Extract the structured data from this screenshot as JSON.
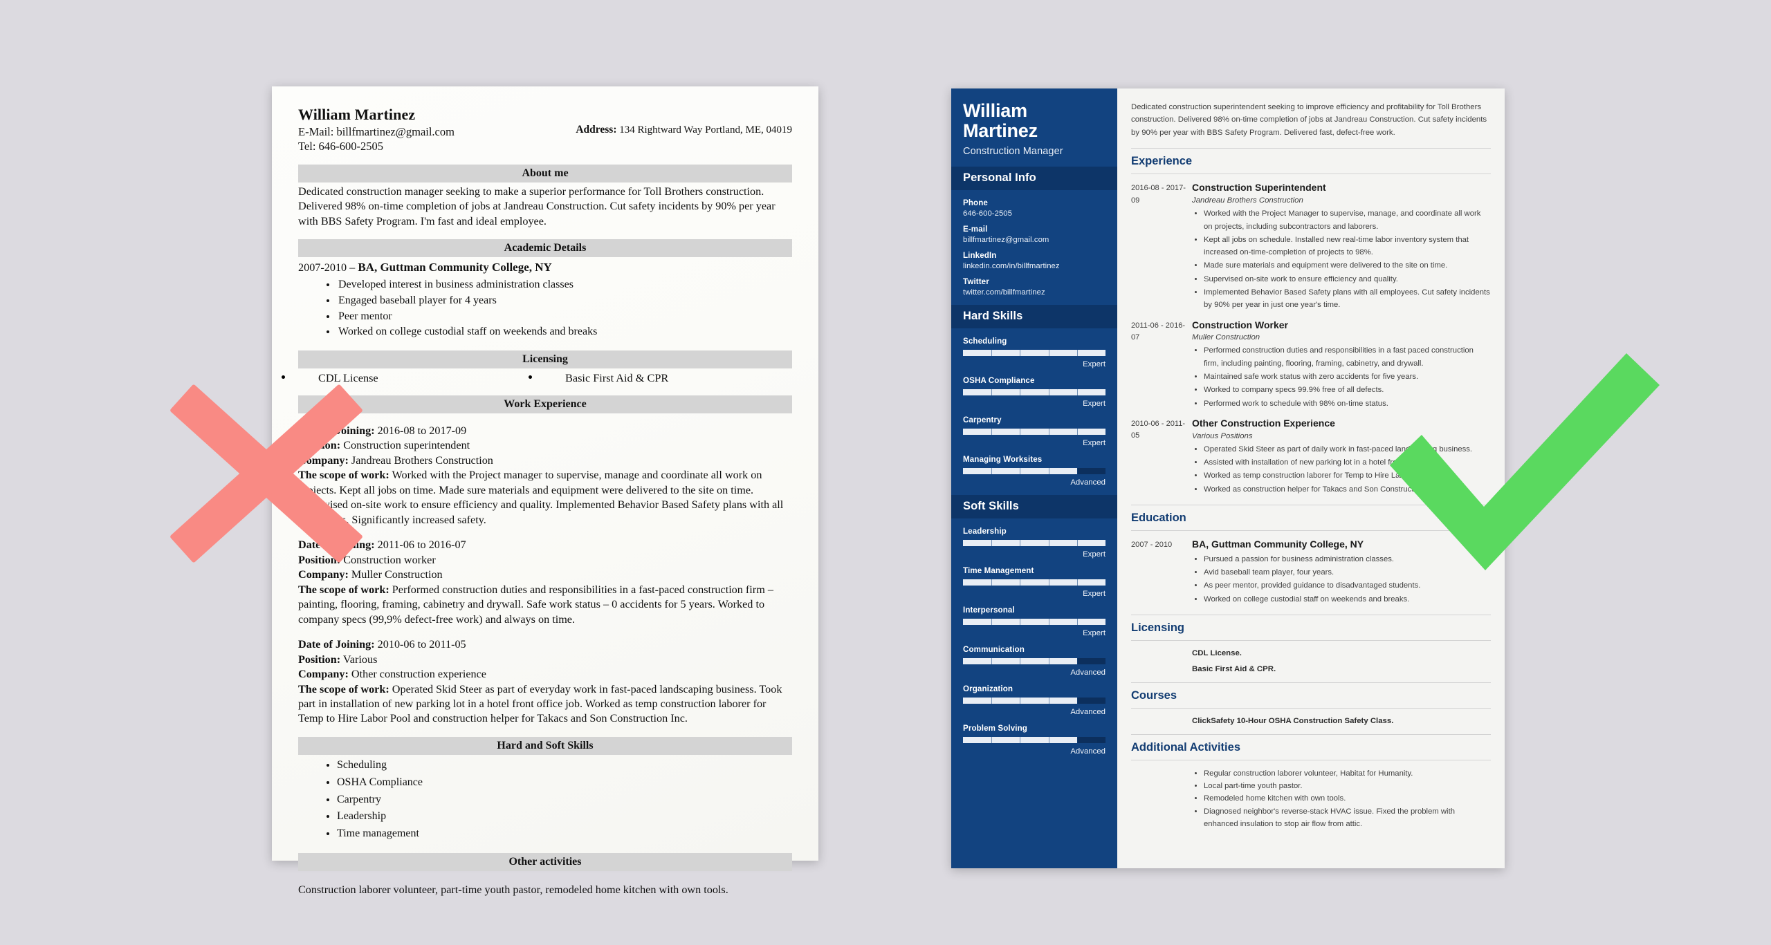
{
  "meta": {
    "background_color": "#dcdae0",
    "bad_mark_color": "#f98a84",
    "good_mark_color": "#5ad95f",
    "accent_blue": "#124380",
    "sidebar_header_blue": "#0d3568"
  },
  "bad_resume": {
    "name": "William Martinez",
    "email_line": "E-Mail: billfmartinez@gmail.com",
    "tel_line": "Tel: 646-600-2505",
    "address_label": "Address:",
    "address_value": "134 Rightward Way Portland, ME, 04019",
    "sections": {
      "about_title": "About me",
      "about_text": "Dedicated construction manager seeking to make a superior performance for Toll Brothers construction. Delivered 98% on-time completion of jobs at Jandreau Construction. Cut safety incidents by 90% per year with BBS Safety Program. I'm fast and ideal employee.",
      "academic_title": "Academic Details",
      "academic_years": "2007-2010 – ",
      "academic_degree": "BA, Guttman Community College, NY",
      "academic_bullets": [
        "Developed interest in business administration classes",
        "Engaged baseball player for 4 years",
        "Peer mentor",
        "Worked on college custodial staff on weekends and breaks"
      ],
      "licensing_title": "Licensing",
      "licensing_items": [
        "CDL License",
        "Basic First Aid & CPR"
      ],
      "work_title": "Work Experience",
      "jobs": [
        {
          "date_label": "Date of Joining:",
          "date_value": " 2016-08 to 2017-09",
          "position_label": "Position:",
          "position_value": " Construction superintendent",
          "company_label": "Company:",
          "company_value": " Jandreau Brothers Construction",
          "scope_label": "The scope of work:",
          "scope_value": " Worked with the Project manager to supervise, manage and coordinate all work on projects. Kept all jobs on time. Made sure materials and equipment were delivered to the site on time. Supervised on-site work to ensure efficiency and quality. Implemented Behavior Based Safety plans with all employees. Significantly increased safety."
        },
        {
          "date_label": "Date of Joining:",
          "date_value": " 2011-06 to 2016-07",
          "position_label": "Position:",
          "position_value": " Construction worker",
          "company_label": "Company:",
          "company_value": " Muller Construction",
          "scope_label": "The scope of work:",
          "scope_value": " Performed construction duties and responsibilities in a fast-paced construction firm – painting, flooring, framing, cabinetry and drywall. Safe work status – 0 accidents for 5 years. Worked to company specs (99,9% defect-free work) and always on time."
        },
        {
          "date_label": "Date of Joining:",
          "date_value": " 2010-06 to 2011-05",
          "position_label": "Position:",
          "position_value": " Various",
          "company_label": "Company:",
          "company_value": " Other construction experience",
          "scope_label": "The scope of work:",
          "scope_value": " Operated Skid Steer as part of everyday work in fast-paced landscaping business. Took part in installation of new parking lot in a hotel front office job. Worked as temp construction laborer for Temp to Hire Labor Pool and construction helper for Takacs and Son Construction Inc."
        }
      ],
      "skills_title": "Hard and Soft Skills",
      "skills": [
        "Scheduling",
        "OSHA Compliance",
        "Carpentry",
        "Leadership",
        "Time management"
      ],
      "other_title": "Other activities",
      "other_text": "Construction laborer volunteer, part-time youth pastor, remodeled home kitchen with own tools."
    }
  },
  "good_resume": {
    "sidebar": {
      "name": "William Martinez",
      "job_title": "Construction Manager",
      "personal_info_title": "Personal Info",
      "personal_info": [
        {
          "label": "Phone",
          "value": "646-600-2505"
        },
        {
          "label": "E-mail",
          "value": "billfmartinez@gmail.com"
        },
        {
          "label": "LinkedIn",
          "value": "linkedin.com/in/billfmartinez"
        },
        {
          "label": "Twitter",
          "value": "twitter.com/billfmartinez"
        }
      ],
      "hard_skills_title": "Hard Skills",
      "hard_skills": [
        {
          "name": "Scheduling",
          "level": "Expert",
          "percent": 100
        },
        {
          "name": "OSHA Compliance",
          "level": "Expert",
          "percent": 100
        },
        {
          "name": "Carpentry",
          "level": "Expert",
          "percent": 100
        },
        {
          "name": "Managing Worksites",
          "level": "Advanced",
          "percent": 80
        }
      ],
      "soft_skills_title": "Soft Skills",
      "soft_skills": [
        {
          "name": "Leadership",
          "level": "Expert",
          "percent": 100
        },
        {
          "name": "Time Management",
          "level": "Expert",
          "percent": 100
        },
        {
          "name": "Interpersonal",
          "level": "Expert",
          "percent": 100
        },
        {
          "name": "Communication",
          "level": "Advanced",
          "percent": 80
        },
        {
          "name": "Organization",
          "level": "Advanced",
          "percent": 80
        },
        {
          "name": "Problem Solving",
          "level": "Advanced",
          "percent": 80
        }
      ]
    },
    "main": {
      "summary": "Dedicated construction superintendent seeking to improve efficiency and profitability for Toll Brothers construction. Delivered 98% on-time completion of jobs at Jandreau Construction. Cut safety incidents by 90% per year with BBS Safety Program. Delivered fast, defect-free work.",
      "experience_title": "Experience",
      "experience": [
        {
          "date": "2016-08 - 2017-09",
          "role": "Construction Superintendent",
          "org": "Jandreau Brothers Construction",
          "bullets": [
            "Worked with the Project Manager to supervise, manage, and coordinate all work on projects, including subcontractors and laborers.",
            "Kept all jobs on schedule. Installed new real-time labor inventory system that increased on-time-completion of projects to 98%.",
            "Made sure materials and equipment were delivered to the site on time.",
            "Supervised on-site work to ensure efficiency and quality.",
            "Implemented Behavior Based Safety plans with all employees. Cut safety incidents by 90% per year in just one year's time."
          ]
        },
        {
          "date": "2011-06 - 2016-07",
          "role": "Construction Worker",
          "org": "Muller Construction",
          "bullets": [
            "Performed construction duties and responsibilities in a fast paced construction firm, including painting, flooring, framing, cabinetry, and drywall.",
            "Maintained safe work status with zero accidents for five years.",
            "Worked to company specs 99.9% free of all defects.",
            "Performed work to schedule with 98% on-time status."
          ]
        },
        {
          "date": "2010-06 - 2011-05",
          "role": "Other Construction Experience",
          "org": "Various Positions",
          "bullets": [
            "Operated Skid Steer as part of daily work in fast-paced landscaping business.",
            "Assisted with installation of new parking lot in a hotel front office job.",
            "Worked as temp construction laborer for Temp to Hire Labor Pool.",
            "Worked as construction helper for Takacs and Son Construction, Inc."
          ]
        }
      ],
      "education_title": "Education",
      "education": [
        {
          "date": "2007 - 2010",
          "role": "BA, Guttman Community College, NY",
          "bullets": [
            "Pursued a passion for business administration classes.",
            "Avid baseball team player, four years.",
            "As peer mentor, provided guidance to disadvantaged students.",
            "Worked on college custodial staff on weekends and breaks."
          ]
        }
      ],
      "licensing_title": "Licensing",
      "licensing": [
        "CDL License.",
        "Basic First Aid & CPR."
      ],
      "courses_title": "Courses",
      "courses": [
        "ClickSafety 10-Hour OSHA Construction Safety Class."
      ],
      "activities_title": "Additional Activities",
      "activities": [
        "Regular construction laborer volunteer, Habitat for Humanity.",
        "Local part-time youth pastor.",
        "Remodeled home kitchen with own tools.",
        "Diagnosed neighbor's reverse-stack HVAC issue. Fixed the problem with enhanced insulation to stop air flow from attic."
      ]
    }
  },
  "annotations": {
    "bad_mark": "red-x-mark",
    "good_mark": "green-check-mark"
  }
}
